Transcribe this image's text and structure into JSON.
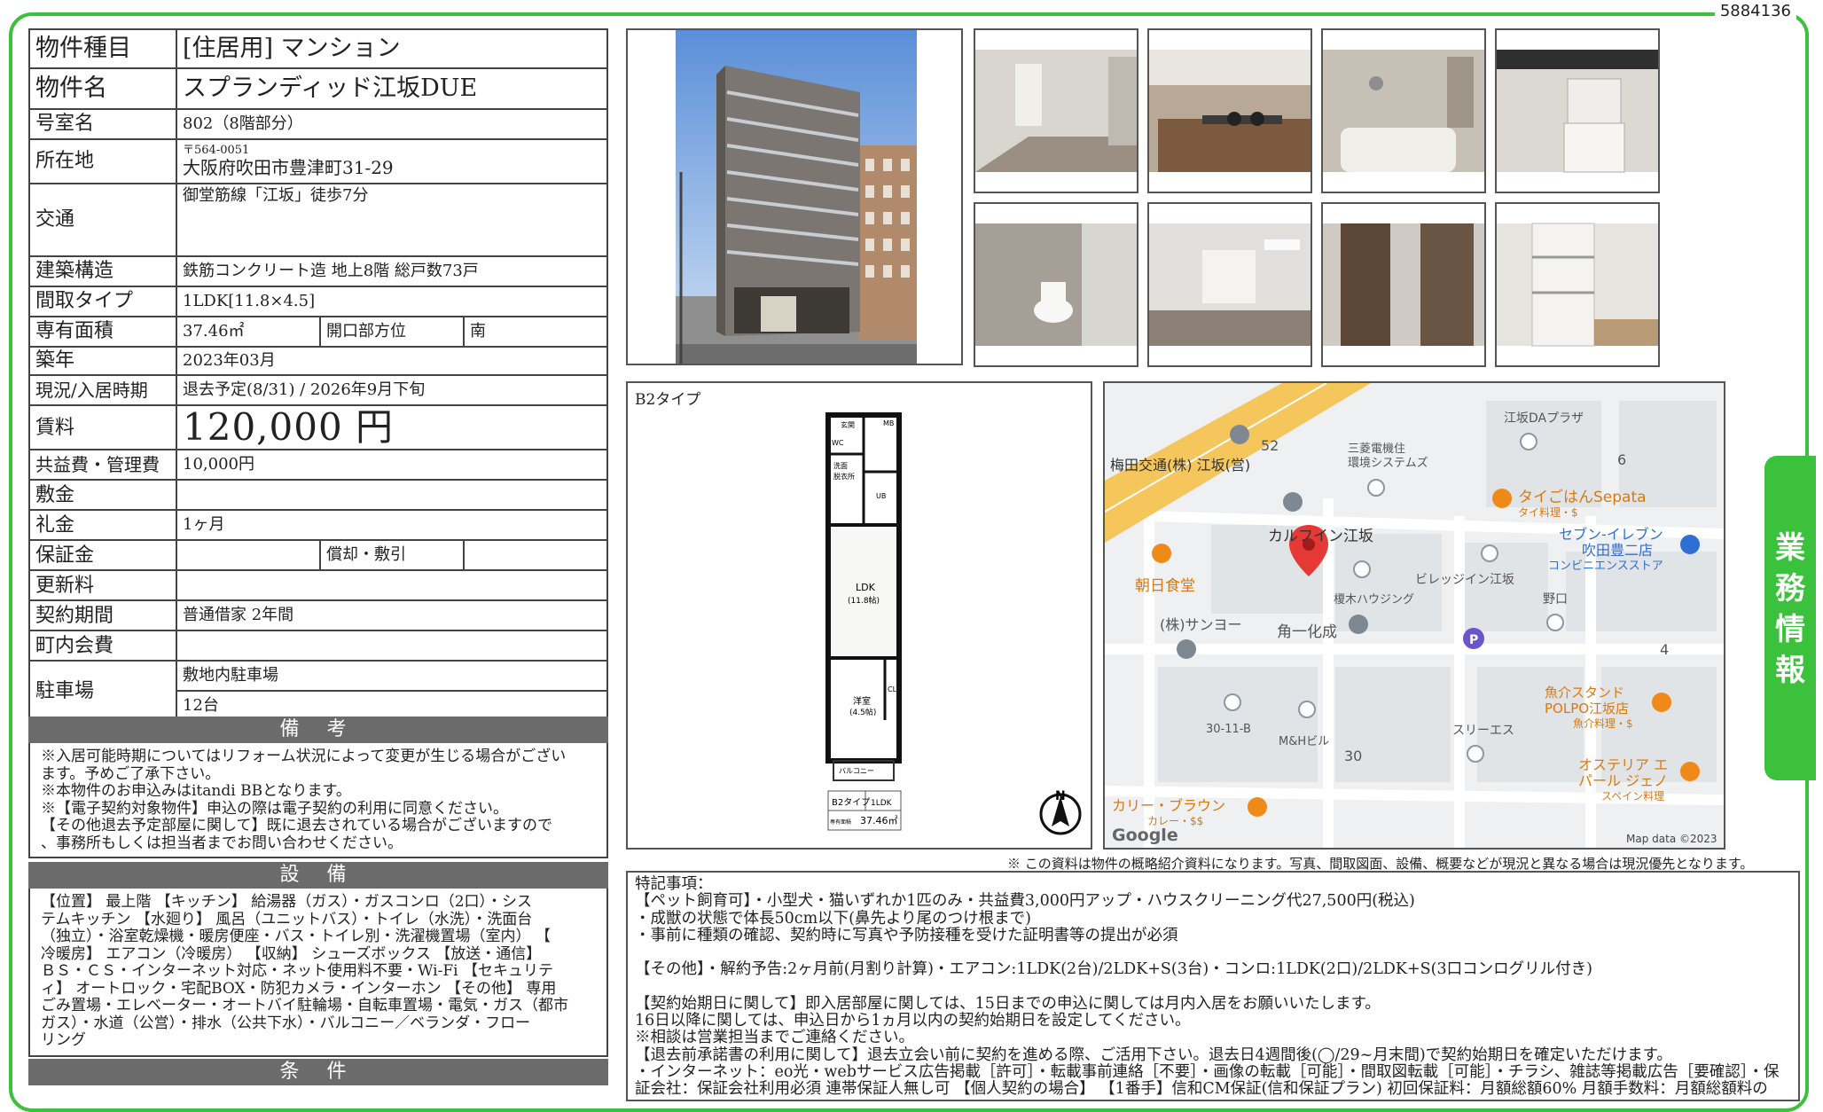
{
  "doc_id": "5884136",
  "property": {
    "type_label": "物件種目",
    "type_value": "[住居用] マンション",
    "name_label": "物件名",
    "name_value": "スプランディッド江坂DUE",
    "room_label": "号室名",
    "room_value": "802（8階部分）",
    "location_label": "所在地",
    "postal": "〒564-0051",
    "address": "大阪府吹田市豊津町31-29",
    "transit_label": "交通",
    "transit_value": "御堂筋線「江坂」徒歩7分",
    "structure_label": "建築構造",
    "structure_value": "鉄筋コンクリート造 地上8階 総戸数73戸",
    "layout_label": "間取タイプ",
    "layout_value": "1LDK[11.8×4.5]",
    "area_label": "専有面積",
    "area_value": "37.46㎡",
    "direction_label": "開口部方位",
    "direction_value": "南",
    "built_label": "築年",
    "built_value": "2023年03月",
    "status_label": "現況/入居時期",
    "status_value": "退去予定(8/31) / 2026年9月下旬",
    "rent_label": "賃料",
    "rent_value": "120,000 円",
    "fee_label": "共益費・管理費",
    "fee_value": "10,000円",
    "deposit_label": "敷金",
    "deposit_value": "",
    "key_money_label": "礼金",
    "key_money_value": "1ヶ月",
    "guarantee_label": "保証金",
    "guarantee_value": "",
    "amort_label": "償却・敷引",
    "amort_value": "",
    "renewal_label": "更新料",
    "renewal_value": "",
    "contract_label": "契約期間",
    "contract_value": "普通借家 2年間",
    "town_fee_label": "町内会費",
    "town_fee_value": "",
    "parking_label": "駐車場",
    "parking_value_1": "敷地内駐車場",
    "parking_value_2": "12台"
  },
  "remarks": {
    "title": "備 考",
    "lines": [
      "※入居可能時期についてはリフォーム状況によって変更が生じる場合がござい",
      "ます。予めご了承下さい。",
      "※本物件のお申込みはitandi BBとなります。",
      "※【電子契約対象物件】申込の際は電子契約の利用に同意ください。",
      "【その他退去予定部屋に関して】既に退去されている場合がございますので",
      "、事務所もしくは担当者までお問い合わせください。"
    ]
  },
  "equipment": {
    "title": "設 備",
    "lines": [
      "【位置】 最上階 【キッチン】 給湯器（ガス）・ガスコンロ（2口）・シス",
      "テムキッチン 【水廻り】 風呂（ユニットバス）・トイレ（水洗）・洗面台",
      "（独立）・浴室乾燥機・暖房便座・バス・トイレ別・洗濯機置場（室内） 【",
      "冷暖房】 エアコン（冷暖房） 【収納】 シューズボックス 【放送・通信】",
      "ＢＳ・ＣＳ・インターネット対応・ネット使用料不要・Wi-Fi 【セキュリテ",
      "ィ】 オートロック・宅配BOX・防犯カメラ・インターホン 【その他】 専用",
      "ごみ置場・エレベーター・オートバイ駐輪場・自転車置場・電気・ガス（都市",
      "ガス）・水道（公営）・排水（公共下水）・バルコニー／ベランダ・フロー",
      "リング"
    ]
  },
  "conditions": {
    "title": "条 件"
  },
  "floorplan": {
    "title": "B2タイプ",
    "rooms": [
      "玄関",
      "MB",
      "WC",
      "洗面",
      "脱衣所",
      "UB",
      "LDK",
      "(11.8帖)",
      "洋室",
      "(4.5帖)",
      "CL",
      "バルコニー"
    ],
    "footer_type": "B2タイプ",
    "footer_layout": "1LDK",
    "footer_area_label": "専有面積",
    "footer_area": "37.46㎡",
    "north": "N"
  },
  "map": {
    "labels": [
      "梅田交通(株) 江坂(営)",
      "52",
      "三菱電機住",
      "環境システムズ",
      "江坂DAプラザ",
      "6",
      "タイごはんSepata",
      "タイ料理・$",
      "カルフイン江坂",
      "セブン-イレブン",
      "吹田豊二店",
      "コンビニエンスストア",
      "朝日食堂",
      "榎木ハウジング",
      "ビレッジイン江坂",
      "野口",
      "(株)サンヨー",
      "角一化成",
      "4",
      "魚介スタンド",
      "POLPO江坂店",
      "魚介料理・$",
      "30-11-B",
      "M&Hビル",
      "スリーエス",
      "30",
      "オステリア エ",
      "パール ジェノ",
      "スペイン料理",
      "カリー・ブラウン",
      "カレー・$$"
    ],
    "google": "Google",
    "credit": "Map data ©2023"
  },
  "disclaimer": "※ この資料は物件の概略紹介資料になります。写真、間取図面、設備、概要などが現況と異なる場合は現況優先となります。",
  "notes": {
    "lines": [
      "特記事項：",
      "【ペット飼育可】・小型犬・猫いずれか1匹のみ・共益費3,000円アップ・ハウスクリーニング代27,500円(税込)",
      "・成獣の状態で体長50cm以下(鼻先より尾のつけ根まで)",
      "・事前に種類の確認、契約時に写真や予防接種を受けた証明書等の提出が必須",
      "",
      "【その他】・解約予告:2ヶ月前(月割り計算)・エアコン:1LDK(2台)/2LDK+S(3台)・コンロ:1LDK(2口)/2LDK+S(3口コンログリル付き)",
      "",
      "【契約始期日に関して】即入居部屋に関しては、15日までの申込に関しては月内入居をお願いいたします。",
      "16日以降に関しては、申込日から1ヵ月以内の契約始期日を設定してください。",
      "※相談は営業担当までご連絡ください。",
      "【退去前承諾書の利用に関して】退去立会い前に契約を進める際、ご活用下さい。退去日4週間後(◯/29~月末間)で契約始期日を確定いただけます。",
      "・インターネット：eo光・webサービス広告掲載［許可］・転載事前連絡［不要］・画像の転載［可能］・間取図転載［可能］・チラシ、雑誌等掲載広告［要確認］・保",
      "証会社：保証会社利用必須 連帯保証人無し可 【個人契約の場合】 【1番手】信和CM保証(信和保証プラン) 初回保証料：月額総額60% 月額手数料：月額総額料の"
    ]
  },
  "side_tab": [
    "業",
    "務",
    "情",
    "報"
  ],
  "colors": {
    "accent": "#3cc13c",
    "section_header": "#6b6b6b",
    "map_road": "#f7c85a"
  }
}
